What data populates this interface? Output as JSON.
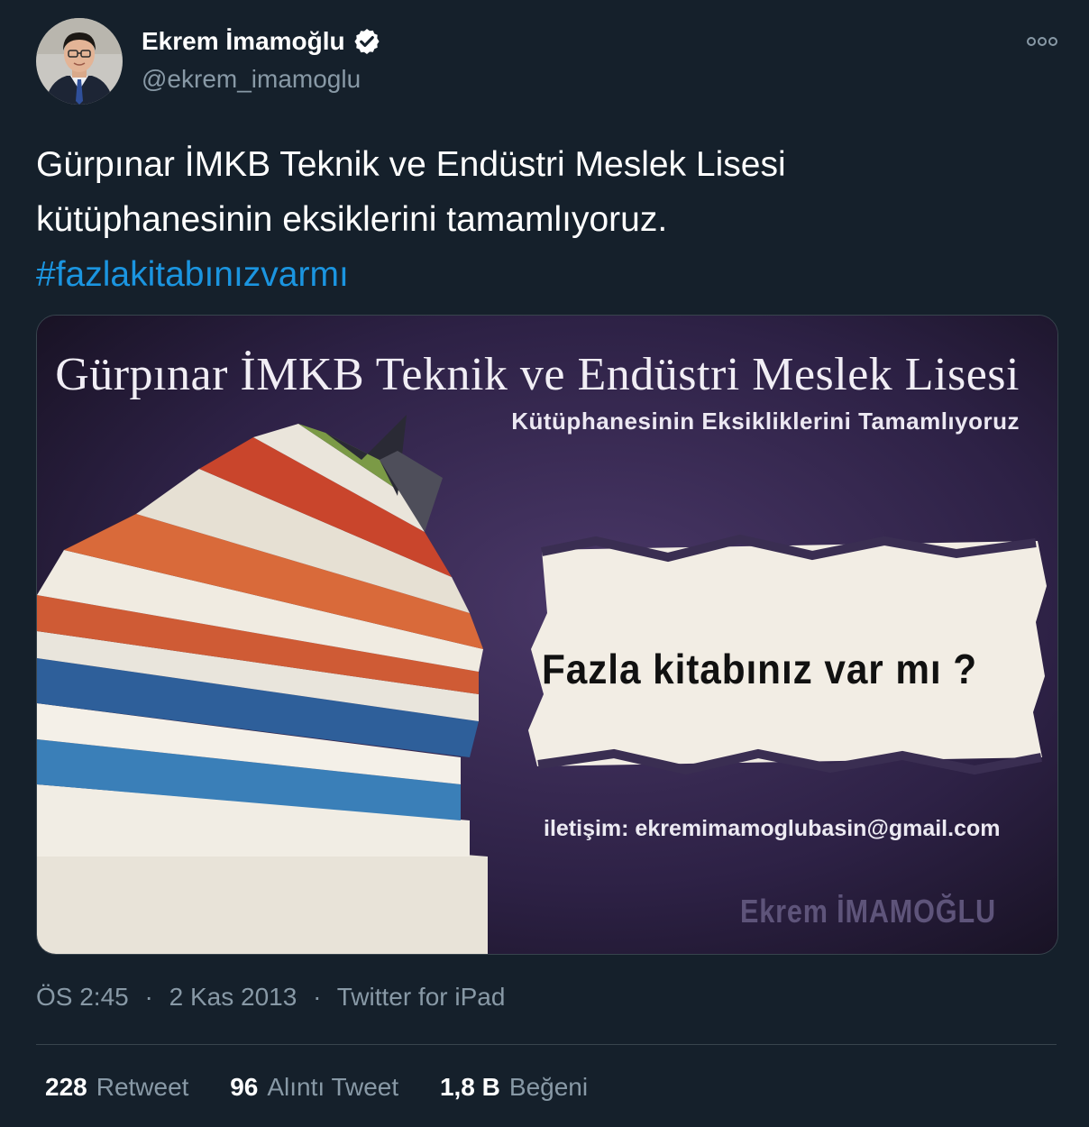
{
  "author": {
    "display_name": "Ekrem İmamoğlu",
    "handle": "@ekrem_imamoglu",
    "verified": true
  },
  "tweet": {
    "text_line1": "Gürpınar İMKB Teknik ve Endüstri Meslek Lisesi",
    "text_line2": "kütüphanesinin eksiklerini tamamlıyoruz.",
    "hashtag": "#fazlakitabınızvarmı"
  },
  "media": {
    "title": "Gürpınar İMKB Teknik ve Endüstri Meslek Lisesi",
    "subtitle": "Kütüphanesinin Eksikliklerini Tamamlıyoruz",
    "question": "Fazla kitabınız var mı ?",
    "contact": "iletişim: ekremimamoglubasin@gmail.com",
    "signature": "Ekrem İMAMOĞLU"
  },
  "meta": {
    "time": "ÖS 2:45",
    "separator": "·",
    "date": "2 Kas 2013",
    "source": "Twitter for iPad"
  },
  "stats": [
    {
      "value": "228",
      "label": "Retweet"
    },
    {
      "value": "96",
      "label": "Alıntı Tweet"
    },
    {
      "value": "1,8 B",
      "label": "Beğeni"
    }
  ],
  "icons": {
    "verified": "verified-badge-icon",
    "more": "more-options-icon"
  },
  "colors": {
    "background": "#15202b",
    "secondary_text": "#8899a6",
    "link": "#1b95e0",
    "divider": "#38444d"
  }
}
